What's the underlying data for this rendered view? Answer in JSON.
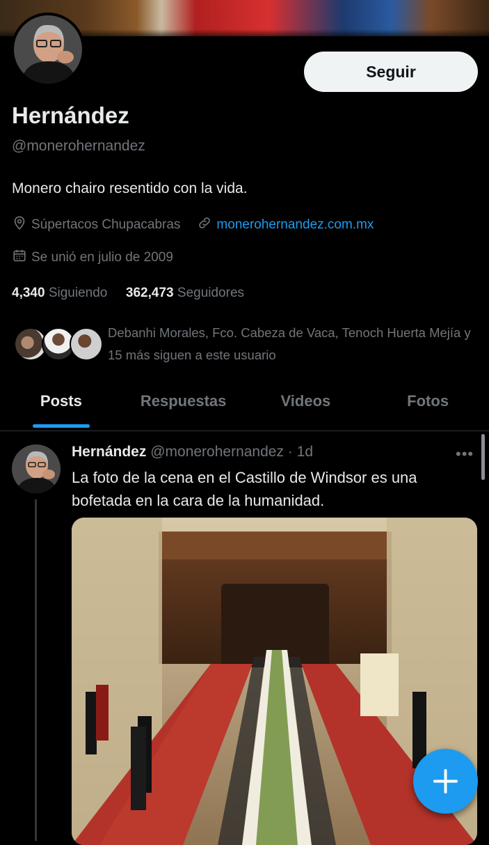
{
  "profile": {
    "name": "Hernández",
    "handle": "@monerohernandez",
    "bio": "Monero chairo resentido con la vida.",
    "location": "Súpertacos Chupacabras",
    "website": "monerohernandez.com.mx",
    "joined": "Se unió en julio de 2009",
    "follow_button": "Seguir"
  },
  "stats": {
    "following_count": "4,340",
    "following_label": "Siguiendo",
    "followers_count": "362,473",
    "followers_label": "Seguidores"
  },
  "known_followers": {
    "text": "Debanhi Morales, Fco. Cabeza de Vaca, Tenoch Huerta Mejía y 15 más siguen a este usuario"
  },
  "tabs": [
    {
      "label": "Posts",
      "active": true
    },
    {
      "label": "Respuestas",
      "active": false
    },
    {
      "label": "Videos",
      "active": false
    },
    {
      "label": "Fotos",
      "active": false
    }
  ],
  "post": {
    "author": "Hernández",
    "handle_time": "@monerohernandez · 1d",
    "text": "La foto de la cena en el Castillo de Windsor es una bofetada en la cara de la humanidad.",
    "more": "•••"
  },
  "colors": {
    "accent": "#1d9bf0",
    "background": "#000000",
    "text": "#e7e9ea",
    "muted": "#71767b"
  },
  "icons": [
    "location-icon",
    "link-icon",
    "calendar-icon",
    "more-icon",
    "compose-plus-icon"
  ]
}
